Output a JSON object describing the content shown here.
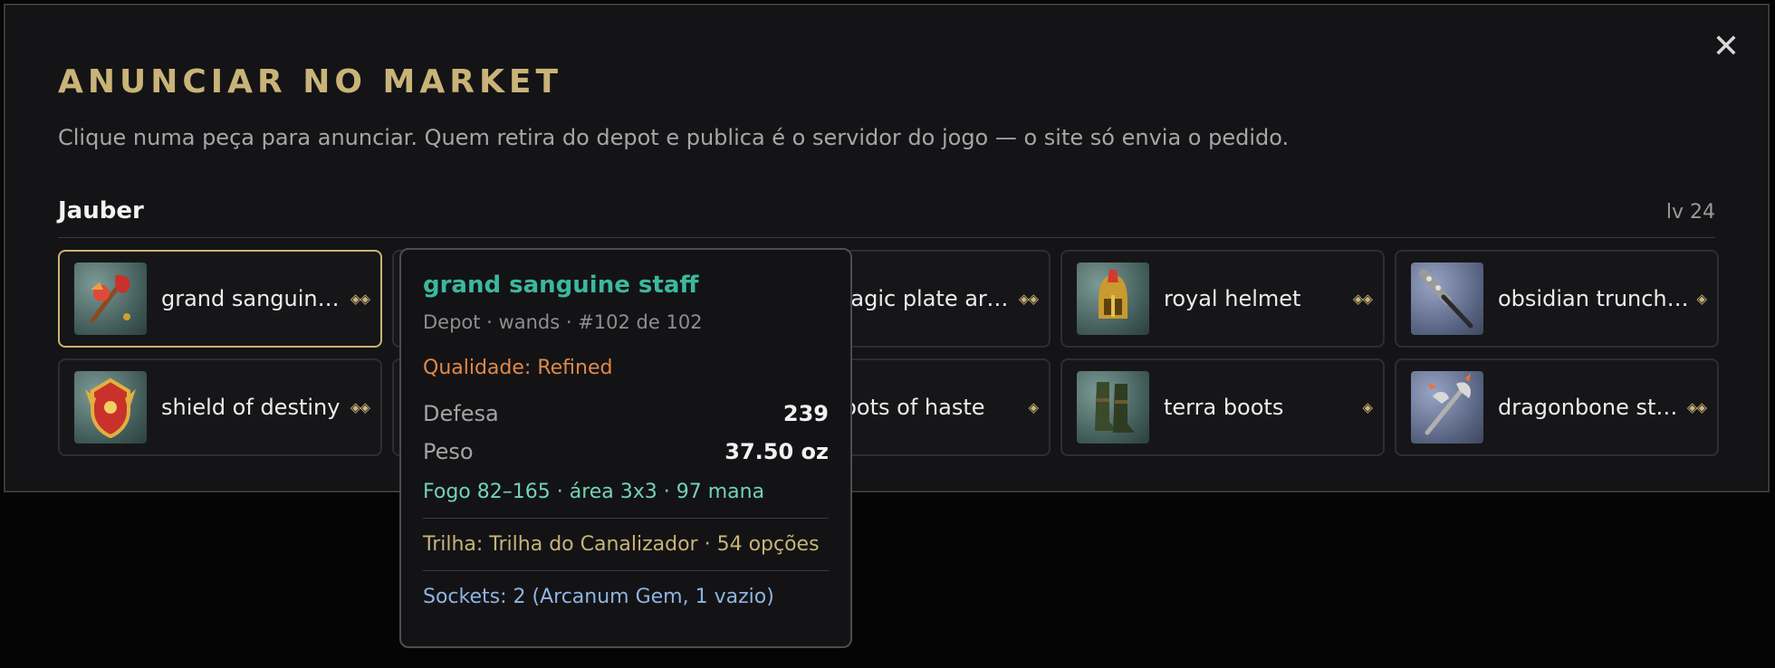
{
  "modal": {
    "title": "ANUNCIAR NO MARKET",
    "subtitle": "Clique numa peça para anunciar. Quem retira do depot e publica é o servidor do jogo — o site só envia o pedido.",
    "close_label": "✕"
  },
  "character": {
    "name": "Jauber",
    "level": "lv 24"
  },
  "items": [
    {
      "name": "grand sanguine staff",
      "tier": "◈◈",
      "icon": "staff-icon",
      "selected": true
    },
    {
      "name": "",
      "tier": "",
      "icon": "hidden-item-icon"
    },
    {
      "name": "magic plate armor",
      "tier": "◈◈",
      "icon": "armor-icon"
    },
    {
      "name": "royal helmet",
      "tier": "◈◈",
      "icon": "helmet-icon"
    },
    {
      "name": "obsidian truncheon",
      "tier": "◈",
      "icon": "club-icon"
    },
    {
      "name": "shield of destiny",
      "tier": "◈◈",
      "icon": "shield-icon"
    },
    {
      "name": "",
      "tier": "",
      "icon": "hidden-item-icon"
    },
    {
      "name": "boots of haste",
      "tier": "◈",
      "icon": "boots-icon"
    },
    {
      "name": "terra boots",
      "tier": "◈",
      "icon": "boots-icon"
    },
    {
      "name": "dragonbone staff",
      "tier": "◈◈",
      "icon": "axe-icon"
    }
  ],
  "tooltip": {
    "title": "grand sanguine staff",
    "meta": "Depot · wands · #102 de 102",
    "quality": "Qualidade: Refined",
    "defense_label": "Defesa",
    "defense_value": "239",
    "weight_label": "Peso",
    "weight_value": "37.50 oz",
    "damage": "Fogo 82–165 · área 3x3 · 97 mana",
    "trail": "Trilha: Trilha do Canalizador · 54 opções",
    "sockets": "Sockets: 2 (Arcanum Gem, 1 vazio)"
  },
  "colors": {
    "accent": "#c9b378",
    "tooltip_title": "#3cb89c",
    "quality": "#e0894a",
    "damage": "#73d3b2",
    "sockets": "#8fb4e0"
  }
}
